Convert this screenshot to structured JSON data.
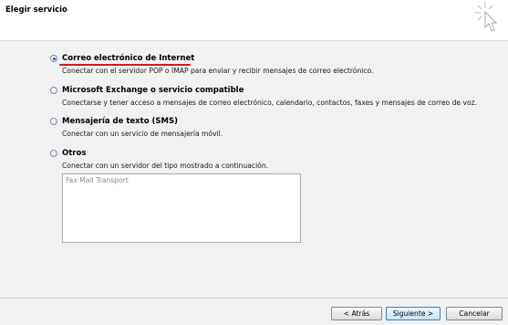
{
  "header": {
    "title": "Elegir servicio",
    "icon": "cursor-sparkle-icon"
  },
  "options": [
    {
      "title": "Correo electrónico de Internet",
      "desc": "Conectar con el servidor POP o IMAP para enviar y recibir mensajes de correo electrónico.",
      "selected": true
    },
    {
      "title": "Microsoft Exchange o servicio compatible",
      "desc": "Conectarse y tener acceso a mensajes de correo electrónico, calendario, contactos, faxes y mensajes de correo de voz.",
      "selected": false
    },
    {
      "title": "Mensajería de texto (SMS)",
      "desc": "Conectar con un servicio de mensajería móvil.",
      "selected": false
    },
    {
      "title": "Otros",
      "desc": "Conectar con un servidor del tipo mostrado a continuación.",
      "selected": false
    }
  ],
  "other_server_types": [
    "Fax Mail Transport"
  ],
  "buttons": {
    "back": "< Atrás",
    "next": "Siguiente >",
    "cancel": "Cancelar"
  },
  "colors": {
    "accent_underline": "#d21c1c",
    "radio_dot": "#2e5aa8"
  }
}
